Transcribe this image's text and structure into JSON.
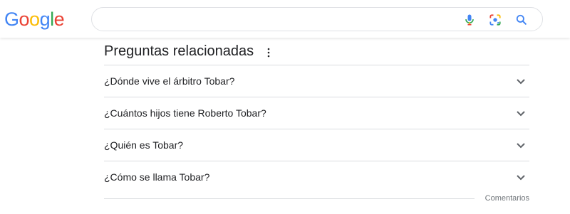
{
  "header": {
    "logo_letters": [
      "G",
      "o",
      "o",
      "g",
      "l",
      "e"
    ],
    "search": {
      "value": "",
      "placeholder": ""
    },
    "icons": [
      "mic-icon",
      "google-lens-icon",
      "search-icon"
    ]
  },
  "paa": {
    "title": "Preguntas relacionadas",
    "menu_icon": "more-vert-icon",
    "questions": [
      {
        "text": "¿Dónde vive el árbitro Tobar?"
      },
      {
        "text": "¿Cuántos hijos tiene Roberto Tobar?"
      },
      {
        "text": "¿Quién es Tobar?"
      },
      {
        "text": "¿Cómo se llama Tobar?"
      }
    ],
    "feedback": "Comentarios"
  },
  "colors": {
    "blue": "#4285f4",
    "red": "#ea4335",
    "yellow": "#fbbc05",
    "green": "#34a853",
    "text": "#202124",
    "divider": "#dadce0",
    "muted": "#70757a"
  }
}
